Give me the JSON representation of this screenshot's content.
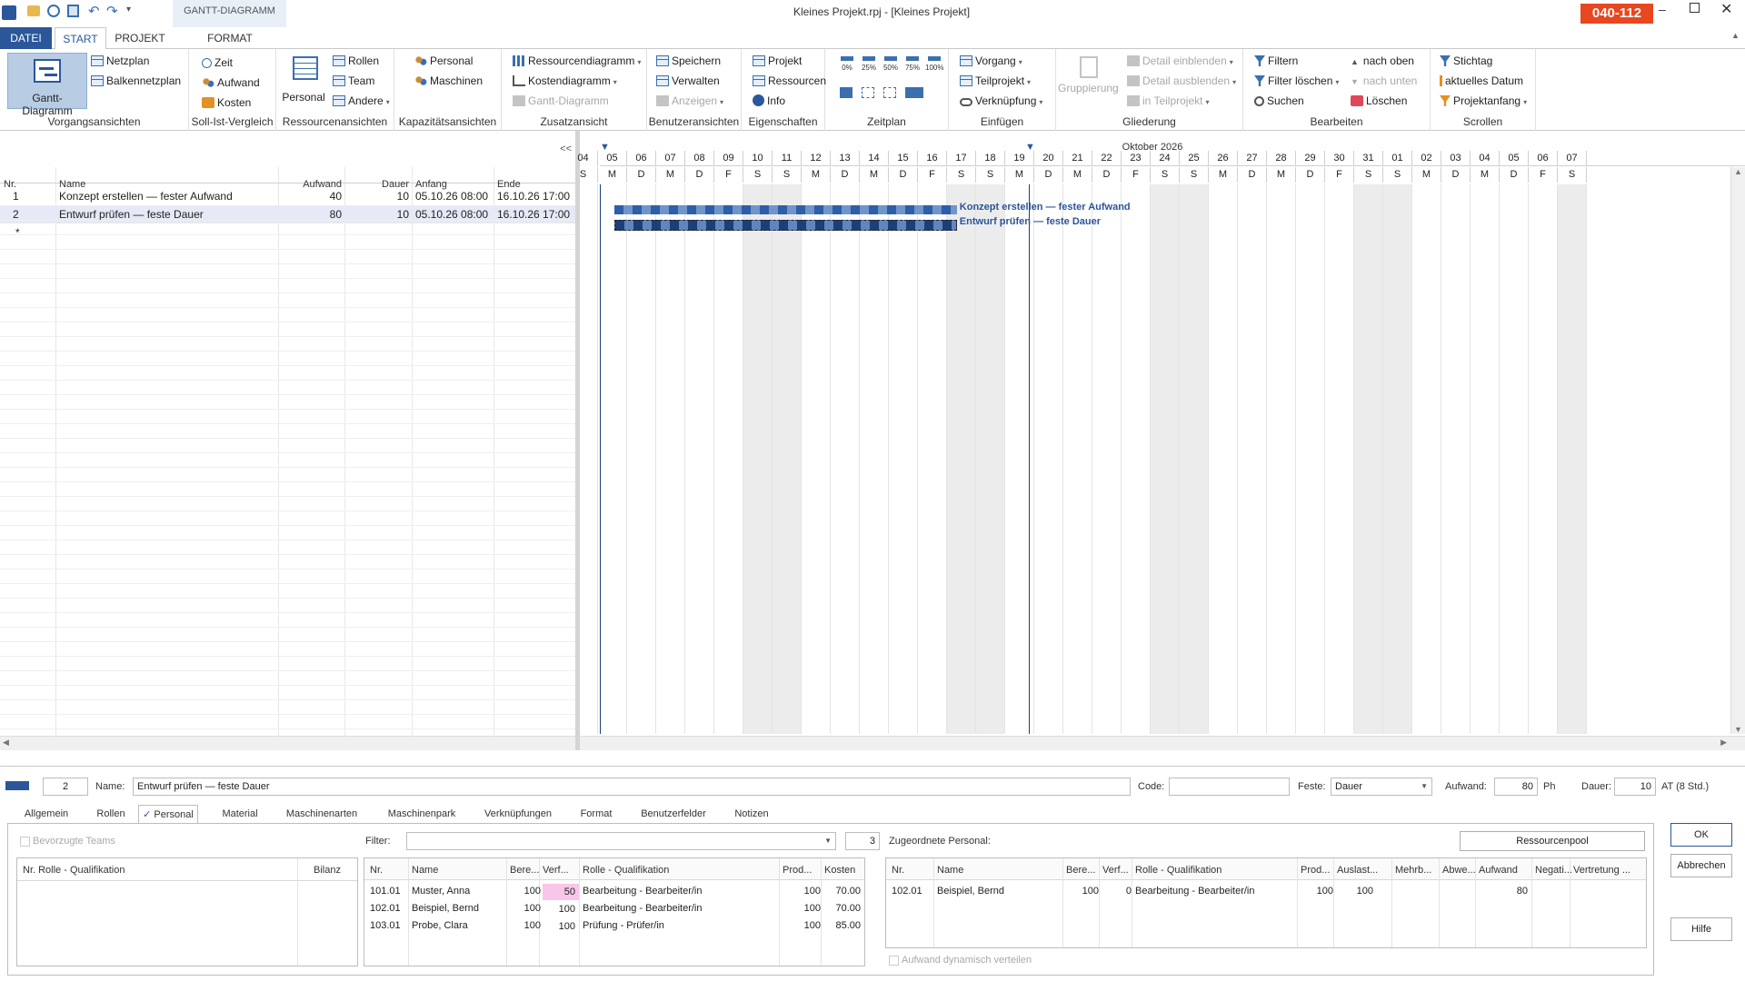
{
  "window": {
    "title": "Kleines Projekt.rpj - [Kleines Projekt]",
    "badge": "040-112",
    "context_tab": "GANTT-DIAGRAMM"
  },
  "tabs": [
    "DATEI",
    "START",
    "PROJEKT",
    "FORMAT"
  ],
  "ribbon": {
    "vorgangsansichten": {
      "label": "Vorgangsansichten",
      "gantt": "Gantt-Diagramm",
      "netzplan": "Netzplan",
      "balkennetzplan": "Balkennetzplan"
    },
    "sollist": {
      "label": "Soll-Ist-Vergleich",
      "zeit": "Zeit",
      "aufwand": "Aufwand",
      "kosten": "Kosten"
    },
    "ressourcen": {
      "label": "Ressourcenansichten",
      "personal": "Personal",
      "rollen": "Rollen",
      "team": "Team",
      "andere": "Andere"
    },
    "kapazitaet": {
      "label": "Kapazitätsansichten",
      "personal": "Personal",
      "maschinen": "Maschinen"
    },
    "zusatz": {
      "label": "Zusatzansicht",
      "ressourcendiagramm": "Ressourcendiagramm",
      "kostendiagramm": "Kostendiagramm",
      "gantt": "Gantt-Diagramm"
    },
    "benutzer": {
      "label": "Benutzeransichten",
      "speichern": "Speichern",
      "verwalten": "Verwalten",
      "anzeigen": "Anzeigen"
    },
    "eigenschaften": {
      "label": "Eigenschaften",
      "projekt": "Projekt",
      "ressourcen": "Ressourcen",
      "info": "Info"
    },
    "zeitplan": {
      "label": "Zeitplan",
      "pcts": [
        "0%",
        "25%",
        "50%",
        "75%",
        "100%"
      ]
    },
    "einfuegen": {
      "label": "Einfügen",
      "vorgang": "Vorgang",
      "teilprojekt": "Teilprojekt",
      "verknuepfung": "Verknüpfung"
    },
    "gliederung": {
      "label": "Gliederung",
      "gruppierung": "Gruppierung",
      "detail_ein": "Detail einblenden",
      "detail_aus": "Detail ausblenden",
      "in_teilprojekt": "in Teilprojekt"
    },
    "bearbeiten": {
      "label": "Bearbeiten",
      "filtern": "Filtern",
      "filter_loeschen": "Filter löschen",
      "suchen": "Suchen",
      "nach_oben": "nach oben",
      "nach_unten": "nach unten",
      "loeschen": "Löschen"
    },
    "scrollen": {
      "label": "Scrollen",
      "stichtag": "Stichtag",
      "aktuelles_datum": "aktuelles Datum",
      "projektanfang": "Projektanfang"
    }
  },
  "task_table": {
    "collapse": "<<",
    "columns": [
      "Nr.",
      "Name",
      "Aufwand",
      "Dauer",
      "Anfang",
      "Ende"
    ],
    "rows": [
      {
        "nr": "1",
        "name": "Konzept erstellen — fester Aufwand",
        "aufwand": "40",
        "dauer": "10",
        "anfang": "05.10.26 08:00",
        "ende": "16.10.26 17:00"
      },
      {
        "nr": "2",
        "name": "Entwurf prüfen — feste Dauer",
        "aufwand": "80",
        "dauer": "10",
        "anfang": "05.10.26 08:00",
        "ende": "16.10.26 17:00"
      }
    ],
    "new_row": "*"
  },
  "gantt": {
    "month": "Oktober 2026",
    "days": [
      "04",
      "05",
      "06",
      "07",
      "08",
      "09",
      "10",
      "11",
      "12",
      "13",
      "14",
      "15",
      "16",
      "17",
      "18",
      "19",
      "20",
      "21",
      "22",
      "23",
      "24",
      "25",
      "26",
      "27",
      "28",
      "29",
      "30",
      "31",
      "01",
      "02",
      "03",
      "04",
      "05",
      "06",
      "07"
    ],
    "weekdays": [
      "S",
      "M",
      "D",
      "M",
      "D",
      "F",
      "S",
      "S",
      "M",
      "D",
      "M",
      "D",
      "F",
      "S",
      "S",
      "M",
      "D",
      "M",
      "D",
      "F",
      "S",
      "S",
      "M",
      "D",
      "M",
      "D",
      "F",
      "S",
      "S",
      "M",
      "D",
      "M",
      "D",
      "F",
      "S"
    ],
    "bars": [
      {
        "label": "Konzept erstellen — fester Aufwand",
        "start_day": 1,
        "end_day": 12.9
      },
      {
        "label": "Entwurf prüfen — feste Dauer",
        "start_day": 1,
        "end_day": 12.9
      }
    ]
  },
  "detail": {
    "nr": "2",
    "name_label": "Name:",
    "name": "Entwurf prüfen — feste Dauer",
    "code_label": "Code:",
    "code": "",
    "feste_label": "Feste:",
    "feste": "Dauer",
    "aufwand_label": "Aufwand:",
    "aufwand": "80",
    "aufwand_unit": "Ph",
    "dauer_label": "Dauer:",
    "dauer": "10",
    "dauer_unit": "AT (8 Std.)",
    "tabs": [
      "Allgemein",
      "Rollen",
      "Personal",
      "Material",
      "Maschinenarten",
      "Maschinenpark",
      "Verknüpfungen",
      "Format",
      "Benutzerfelder",
      "Notizen"
    ],
    "bevorzugte_teams": "Bevorzugte Teams",
    "left_cols": [
      "Nr. Rolle - Qualifikation",
      "Bilanz"
    ],
    "filter_label": "Filter:",
    "filter_count": "3",
    "avail_cols": [
      "Nr.",
      "Name",
      "Bere...",
      "Verf...",
      "Rolle - Qualifikation",
      "Prod...",
      "Kosten"
    ],
    "avail_rows": [
      {
        "nr": "101.01",
        "name": "Muster, Anna",
        "bere": "100",
        "verf": "50",
        "rolle": "Bearbeitung - Bearbeiter/in",
        "prod": "100",
        "kosten": "70.00"
      },
      {
        "nr": "102.01",
        "name": "Beispiel, Bernd",
        "bere": "100",
        "verf": "100",
        "rolle": "Bearbeitung - Bearbeiter/in",
        "prod": "100",
        "kosten": "70.00"
      },
      {
        "nr": "103.01",
        "name": "Probe, Clara",
        "bere": "100",
        "verf": "100",
        "rolle": "Prüfung - Prüfer/in",
        "prod": "100",
        "kosten": "85.00"
      }
    ],
    "assigned_label": "Zugeordnete Personal:",
    "ressourcenpool": "Ressourcenpool",
    "assigned_cols": [
      "Nr.",
      "Name",
      "Bere...",
      "Verf...",
      "Rolle - Qualifikation",
      "Prod...",
      "Auslast...",
      "Mehrb...",
      "Abwe...",
      "Aufwand",
      "Negati...",
      "Vertretung ..."
    ],
    "assigned_rows": [
      {
        "nr": "102.01",
        "name": "Beispiel, Bernd",
        "bere": "100",
        "verf": "0",
        "rolle": "Bearbeitung - Bearbeiter/in",
        "prod": "100",
        "auslast": "100",
        "aufwand": "80"
      }
    ],
    "aufwand_dynamisch": "Aufwand dynamisch verteilen",
    "ok": "OK",
    "abbrechen": "Abbrechen",
    "hilfe": "Hilfe"
  },
  "colors": {
    "accent": "#2b579a",
    "badge": "#e8471f",
    "bar": "#2e5ea8",
    "highlight": "#f8c6e8"
  }
}
